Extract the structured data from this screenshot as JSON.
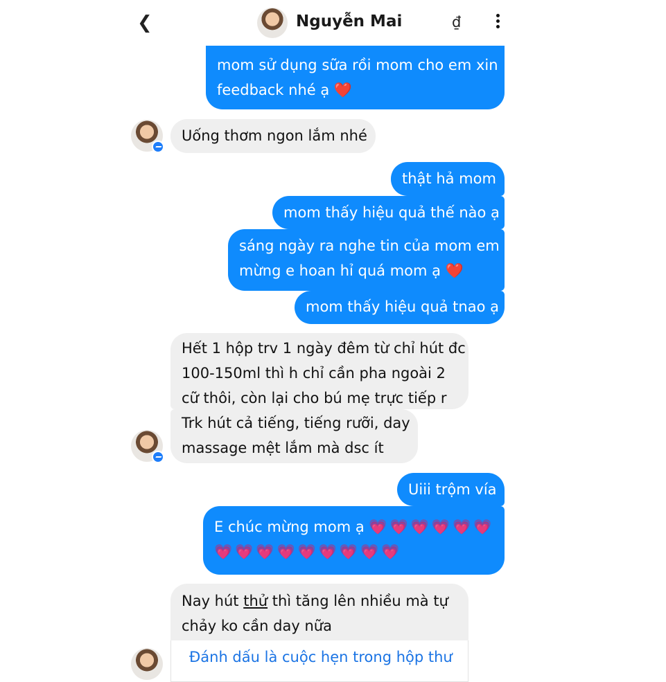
{
  "header": {
    "back_icon": "chevron-left-icon",
    "contact_name": "Nguyễn Mai",
    "currency_symbol": "₫",
    "more_icon": "vertical-ellipsis-icon"
  },
  "messages": [
    {
      "dir": "out",
      "lines": [
        "mom sử dụng sữa rồi mom cho em xin",
        "feedback nhé ạ"
      ],
      "emoji": "❤️"
    },
    {
      "dir": "in",
      "lines": [
        "Uống thơm ngon lắm nhé"
      ]
    },
    {
      "dir": "out",
      "lines": [
        "thật hả mom"
      ]
    },
    {
      "dir": "out",
      "lines": [
        "mom thấy hiệu quả thế nào ạ"
      ]
    },
    {
      "dir": "out",
      "lines": [
        "sáng ngày ra nghe tin của mom em",
        "mừng e hoan hỉ quá mom ạ"
      ],
      "emoji": "❤️"
    },
    {
      "dir": "out",
      "lines": [
        "mom thấy hiệu quả tnao ạ"
      ]
    },
    {
      "dir": "in",
      "lines": [
        "Hết 1 hộp trv 1 ngày đêm từ chỉ hút đc",
        "100-150ml thì h chỉ cần pha ngoài 2",
        "cữ thôi, còn lại cho bú mẹ trực tiếp r"
      ]
    },
    {
      "dir": "in",
      "lines": [
        "Trk hút cả tiếng, tiếng rưỡi, day",
        "massage mệt lắm mà dsc ít"
      ]
    },
    {
      "dir": "out",
      "lines": [
        "Uiii trộm vía"
      ]
    },
    {
      "dir": "out",
      "lines": [
        "E chúc mừng mom ạ"
      ],
      "emoji_row1": "💗💗💗💗💗💗",
      "emoji_row2": "💗💗💗💗💗💗💗💗💗"
    },
    {
      "dir": "in",
      "parts": [
        "Nay hút ",
        "thử",
        " thì tăng lên nhiều mà tự"
      ],
      "line2": "chảy ko cần day nữa"
    }
  ],
  "card": {
    "link_text": "Đánh dấu là cuộc hẹn trong hộp thư"
  },
  "colors": {
    "outgoing": "#0f8bfd",
    "incoming": "#efefef",
    "link": "#1b74e4"
  }
}
